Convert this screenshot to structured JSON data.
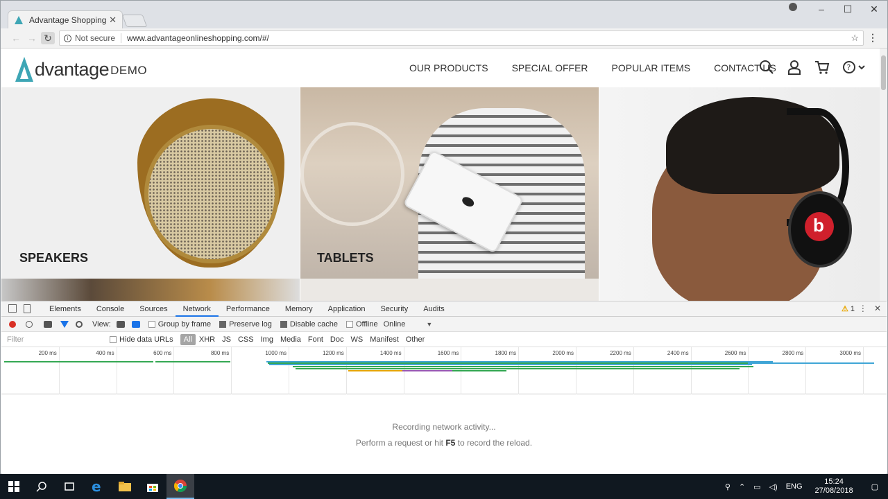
{
  "browser": {
    "tab_title": "Advantage Shopping",
    "tab_close": "✕",
    "security_label": "Not secure",
    "url": "www.advantageonlineshopping.com/#/"
  },
  "site": {
    "logo_brand": "dvantage",
    "logo_demo": "DEMO",
    "nav": [
      "OUR PRODUCTS",
      "SPECIAL OFFER",
      "POPULAR ITEMS",
      "CONTACT US"
    ],
    "tiles": {
      "speakers": "SPEAKERS",
      "tablets": "TABLETS"
    },
    "accent_color": "#3ea6b5"
  },
  "devtools": {
    "tabs": [
      "Elements",
      "Console",
      "Sources",
      "Network",
      "Performance",
      "Memory",
      "Application",
      "Security",
      "Audits"
    ],
    "active_tab": "Network",
    "warning_count": "1",
    "controls": {
      "view_label": "View:",
      "group_by_frame": "Group by frame",
      "preserve_log": "Preserve log",
      "disable_cache": "Disable cache",
      "offline": "Offline",
      "throttling": "Online"
    },
    "filter_placeholder": "Filter",
    "hide_data_urls": "Hide data URLs",
    "type_filters": [
      "All",
      "XHR",
      "JS",
      "CSS",
      "Img",
      "Media",
      "Font",
      "Doc",
      "WS",
      "Manifest",
      "Other"
    ],
    "timeline_ticks": [
      "200 ms",
      "400 ms",
      "600 ms",
      "800 ms",
      "1000 ms",
      "1200 ms",
      "1400 ms",
      "1600 ms",
      "1800 ms",
      "2000 ms",
      "2200 ms",
      "2400 ms",
      "2600 ms",
      "2800 ms",
      "3000 ms"
    ],
    "empty_line1": "Recording network activity...",
    "empty_line2_pre": "Perform a request or hit ",
    "empty_line2_key": "F5",
    "empty_line2_post": " to record the reload."
  },
  "taskbar": {
    "language": "ENG",
    "time": "15:24",
    "date": "27/08/2018"
  }
}
